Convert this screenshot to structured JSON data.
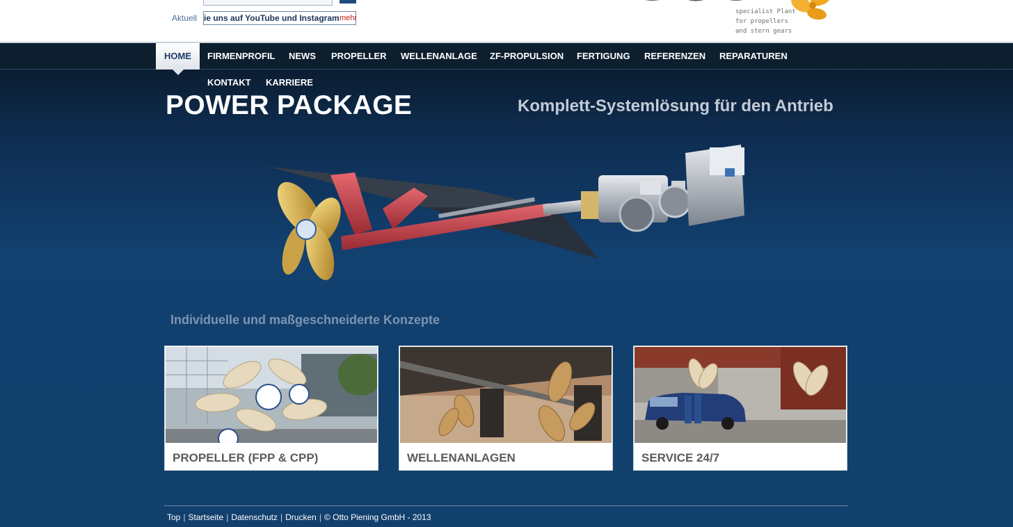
{
  "header": {
    "news_label": "Aktuell",
    "news_ticker_text": "ie uns auf YouTube und Instagram",
    "news_ticker_more": "mehr",
    "logo_tagline": "specialist Plant\nfor propellers\nand stern gears",
    "logo_wordmark_fragment": "Piening Propeller"
  },
  "nav": {
    "items": [
      {
        "label": "HOME",
        "active": true
      },
      {
        "label": "FIRMENPROFIL"
      },
      {
        "label": "NEWS"
      },
      {
        "label": "PROPELLER"
      },
      {
        "label": "WELLENANLAGE"
      },
      {
        "label": "ZF-PROPULSION"
      },
      {
        "label": "FERTIGUNG"
      },
      {
        "label": "REFERENZEN"
      },
      {
        "label": "REPARATUREN"
      },
      {
        "label": "KONTAKT"
      },
      {
        "label": "KARRIERE"
      }
    ]
  },
  "hero": {
    "title": "POWER PACKAGE",
    "subtitle": "Komplett-Systemlösung für den Antrieb",
    "tagline": "Individuelle und maßgeschneiderte Konzepte"
  },
  "cards": [
    {
      "label": "PROPELLER (FPP & CPP)",
      "image": "propeller-exhibit-photo"
    },
    {
      "label": "WELLENANLAGEN",
      "image": "shaft-propeller-ship-hull-photo"
    },
    {
      "label": "SERVICE 24/7",
      "image": "service-van-technicians-photo"
    }
  ],
  "footer": {
    "links": [
      "Top",
      "Startseite",
      "Datenschutz",
      "Drucken"
    ],
    "copyright": "© Otto Piening GmbH - 2013"
  },
  "colors": {
    "nav_bg": "#0d1e2e",
    "hero_bg": "#12406f",
    "accent_link": "#cc1a1a",
    "card_label": "#5b5b5b",
    "logo_orange": "#f0a81c"
  }
}
